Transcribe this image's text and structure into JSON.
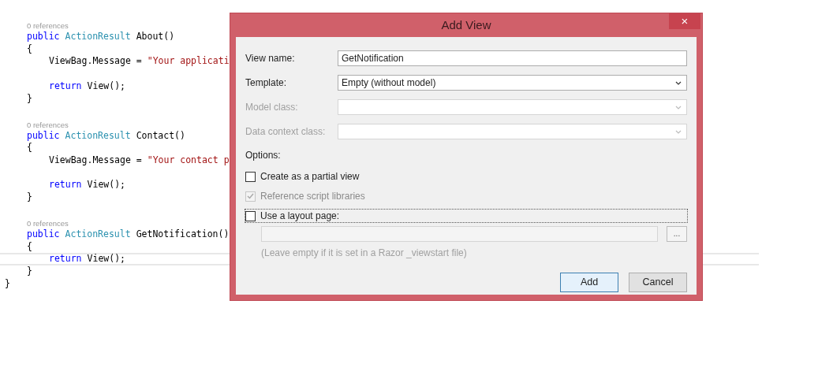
{
  "editor": {
    "items": [
      {
        "kind": "block",
        "children": [
          {
            "kind": "codelens",
            "text": "0 references"
          },
          {
            "kind": "line",
            "current": false,
            "tokens": [
              {
                "kind": "keyword",
                "text": "public"
              },
              {
                "kind": "type",
                "text": "ActionResult"
              },
              {
                "kind": "plain",
                "text": "About()"
              }
            ]
          },
          {
            "kind": "line",
            "current": false,
            "tokens": [
              {
                "kind": "plain",
                "text": "{"
              }
            ]
          },
          {
            "kind": "block",
            "children": [
              {
                "kind": "line",
                "current": false,
                "tokens": [
                  {
                    "kind": "plain",
                    "text": "ViewBag.Message ="
                  },
                  {
                    "kind": "string",
                    "text": "\"Your applicati"
                  }
                ]
              },
              {
                "kind": "blank"
              },
              {
                "kind": "line",
                "current": false,
                "tokens": [
                  {
                    "kind": "keyword",
                    "text": "return"
                  },
                  {
                    "kind": "plain",
                    "text": "View();"
                  }
                ]
              }
            ]
          },
          {
            "kind": "line",
            "current": false,
            "tokens": [
              {
                "kind": "plain",
                "text": "}"
              }
            ]
          },
          {
            "kind": "blank"
          },
          {
            "kind": "codelens",
            "text": "0 references"
          },
          {
            "kind": "line",
            "current": false,
            "tokens": [
              {
                "kind": "keyword",
                "text": "public"
              },
              {
                "kind": "type",
                "text": "ActionResult"
              },
              {
                "kind": "plain",
                "text": "Contact()"
              }
            ]
          },
          {
            "kind": "line",
            "current": false,
            "tokens": [
              {
                "kind": "plain",
                "text": "{"
              }
            ]
          },
          {
            "kind": "block",
            "children": [
              {
                "kind": "line",
                "current": false,
                "tokens": [
                  {
                    "kind": "plain",
                    "text": "ViewBag.Message ="
                  },
                  {
                    "kind": "string",
                    "text": "\"Your contact p"
                  }
                ]
              },
              {
                "kind": "blank"
              },
              {
                "kind": "line",
                "current": false,
                "tokens": [
                  {
                    "kind": "keyword",
                    "text": "return"
                  },
                  {
                    "kind": "plain",
                    "text": "View();"
                  }
                ]
              }
            ]
          },
          {
            "kind": "line",
            "current": false,
            "tokens": [
              {
                "kind": "plain",
                "text": "}"
              }
            ]
          },
          {
            "kind": "blank"
          },
          {
            "kind": "codelens",
            "text": "0 references"
          },
          {
            "kind": "line",
            "current": false,
            "tokens": [
              {
                "kind": "keyword",
                "text": "public"
              },
              {
                "kind": "type",
                "text": "ActionResult"
              },
              {
                "kind": "plain",
                "text": "GetNotification()"
              }
            ]
          },
          {
            "kind": "line",
            "current": false,
            "tokens": [
              {
                "kind": "plain",
                "text": "{"
              }
            ]
          },
          {
            "kind": "block",
            "children": [
              {
                "kind": "line",
                "current": true,
                "tokens": [
                  {
                    "kind": "keyword",
                    "text": "return"
                  },
                  {
                    "kind": "plain",
                    "text": "View();"
                  }
                ]
              }
            ]
          },
          {
            "kind": "line",
            "current": false,
            "tokens": [
              {
                "kind": "plain",
                "text": "}"
              }
            ]
          }
        ]
      },
      {
        "kind": "line",
        "current": false,
        "tokens": [
          {
            "kind": "plain",
            "text": "}"
          }
        ]
      }
    ]
  },
  "dialog": {
    "title": "Add View",
    "close": "×",
    "fields": [
      {
        "label": "View name:",
        "kind": "text",
        "value": "GetNotification",
        "disabled": false
      },
      {
        "label": "Template:",
        "kind": "dropdown",
        "value": "Empty (without model)",
        "disabled": false
      },
      {
        "label": "Model class:",
        "kind": "dropdown",
        "disabled": true
      },
      {
        "label": "Data context class:",
        "kind": "dropdown",
        "disabled": true
      }
    ],
    "options_label": "Options:",
    "options": [
      {
        "label": "Create as a partial view",
        "checked": false,
        "disabled": false,
        "focused": false
      },
      {
        "label": "Reference script libraries",
        "checked": true,
        "disabled": true,
        "focused": false
      },
      {
        "label": "Use a layout page:",
        "checked": false,
        "disabled": false,
        "focused": true
      }
    ],
    "layout_page": {
      "disabled": true,
      "browse": "...",
      "hint": "(Leave empty if it is set in a Razor _viewstart file)"
    },
    "buttons": [
      {
        "label": "Add",
        "default": true
      },
      {
        "label": "Cancel",
        "default": false
      }
    ]
  }
}
